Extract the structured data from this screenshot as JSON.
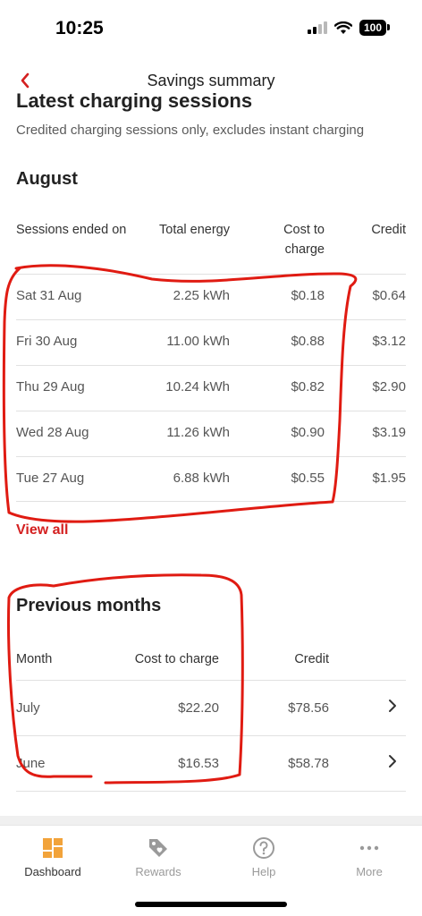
{
  "status": {
    "time": "10:25",
    "battery": "100"
  },
  "nav": {
    "title": "Savings summary"
  },
  "latest": {
    "heading": "Latest charging sessions",
    "subtitle": "Credited charging sessions only, excludes instant charging",
    "month": "August",
    "columns": [
      "Sessions ended on",
      "Total energy",
      "Cost to charge",
      "Credit"
    ],
    "rows": [
      {
        "date": "Sat 31 Aug",
        "energy": "2.25 kWh",
        "cost": "$0.18",
        "credit": "$0.64"
      },
      {
        "date": "Fri 30 Aug",
        "energy": "11.00 kWh",
        "cost": "$0.88",
        "credit": "$3.12"
      },
      {
        "date": "Thu 29 Aug",
        "energy": "10.24 kWh",
        "cost": "$0.82",
        "credit": "$2.90"
      },
      {
        "date": "Wed 28 Aug",
        "energy": "11.26 kWh",
        "cost": "$0.90",
        "credit": "$3.19"
      },
      {
        "date": "Tue 27 Aug",
        "energy": "6.88 kWh",
        "cost": "$0.55",
        "credit": "$1.95"
      }
    ],
    "view_all": "View all"
  },
  "previous": {
    "heading": "Previous months",
    "columns": [
      "Month",
      "Cost to charge",
      "Credit"
    ],
    "rows": [
      {
        "month": "July",
        "cost": "$22.20",
        "credit": "$78.56"
      },
      {
        "month": "June",
        "cost": "$16.53",
        "credit": "$58.78"
      }
    ]
  },
  "tabs": [
    {
      "label": "Dashboard",
      "icon": "dashboard-icon",
      "active": true
    },
    {
      "label": "Rewards",
      "icon": "tag-icon",
      "active": false
    },
    {
      "label": "Help",
      "icon": "help-icon",
      "active": false
    },
    {
      "label": "More",
      "icon": "more-icon",
      "active": false
    }
  ],
  "colors": {
    "accent": "#d42020",
    "active_tab": "#f2a33a",
    "annotation": "#e01b12"
  }
}
